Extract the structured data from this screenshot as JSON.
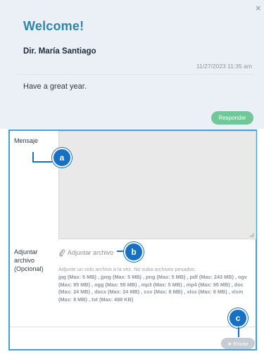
{
  "header": {
    "title": "Welcome!",
    "close_icon": "×",
    "sender": "Dir. María Santiago",
    "date": "11/27/2023 11:35 am",
    "message": "Have a great year.",
    "reply_label": "Responder"
  },
  "compose": {
    "message_label": "Mensaje",
    "attach_label_lines": [
      "Adjuntar",
      "archivo",
      "(Opcional)"
    ],
    "attach_link": "Adjuntar archivo",
    "note": "Adjunte un solo archivo a la vez. No suba archivos pesados.",
    "file_types": "jpg (Max: 5 MB) , jpeg (Max: 5 MB) , png (Max: 5 MB) , pdf (Max: 243 MB) , ogv (Max: 95 MB) , ogg (Max: 95 MB) , mp3 (Max: 5 MB) , mp4 (Max: 95 MB) , doc (Max: 24 MB) , docx (Max: 24 MB) , csv (Max: 8 MB) , xlsx (Max: 8 MB) , xlsm (Max: 8 MB) , txt (Max: 488 KB)",
    "send_label": "Enviar"
  },
  "markers": {
    "a": "a",
    "b": "b",
    "c": "c"
  },
  "colors": {
    "accent": "#2e86ab",
    "reply": "#6fc79a",
    "marker": "#1670c4",
    "highlight_border": "#3f9fe6"
  },
  "icons": {
    "close": "close-icon",
    "attach": "paperclip-icon",
    "send": "paper-plane-icon"
  }
}
